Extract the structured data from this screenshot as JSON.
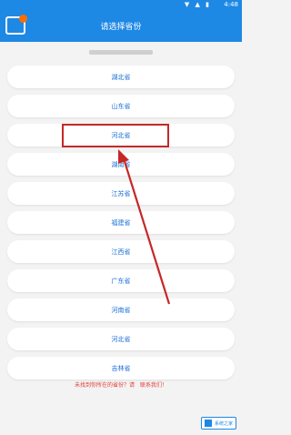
{
  "statusbar": {
    "time": "4:48",
    "icons": "▼ ▲ ▮"
  },
  "header": {
    "title": "请选择省份"
  },
  "provinces": [
    {
      "label": "湖北省"
    },
    {
      "label": "山东省"
    },
    {
      "label": "河北省"
    },
    {
      "label": "湖南省"
    },
    {
      "label": "江苏省"
    },
    {
      "label": "福建省"
    },
    {
      "label": "江西省"
    },
    {
      "label": "广东省"
    },
    {
      "label": "河南省"
    },
    {
      "label": "河北省"
    },
    {
      "label": "吉林省"
    }
  ],
  "footer": {
    "notice": "未找到你所在的省份？请",
    "link": "联系我们！"
  },
  "watermark": {
    "text": "系统之家"
  },
  "colors": {
    "accent": "#1e88e5",
    "annotation": "#c62828"
  }
}
